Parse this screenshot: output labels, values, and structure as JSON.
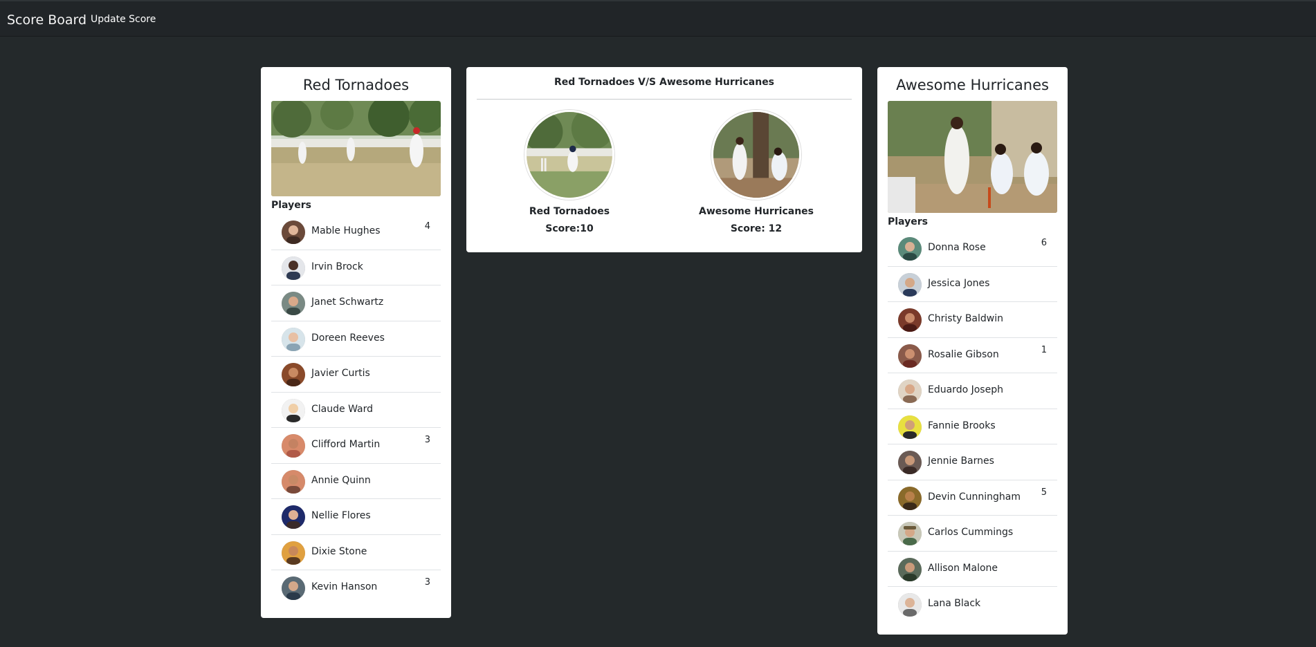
{
  "navbar": {
    "brand": "Score Board",
    "links": [
      "Update Score"
    ]
  },
  "match": {
    "title": "Red Tornadoes V/S Awesome Hurricanes",
    "teams": [
      {
        "name": "Red Tornadoes",
        "score_label": "Score:10"
      },
      {
        "name": "Awesome Hurricanes",
        "score_label": "Score: 12"
      }
    ]
  },
  "teams": [
    {
      "name": "Red Tornadoes",
      "players_label": "Players",
      "players": [
        {
          "name": "Mable Hughes",
          "score": "4"
        },
        {
          "name": "Irvin Brock",
          "score": ""
        },
        {
          "name": "Janet Schwartz",
          "score": ""
        },
        {
          "name": "Doreen Reeves",
          "score": ""
        },
        {
          "name": "Javier Curtis",
          "score": ""
        },
        {
          "name": "Claude Ward",
          "score": ""
        },
        {
          "name": "Clifford Martin",
          "score": "3"
        },
        {
          "name": "Annie Quinn",
          "score": ""
        },
        {
          "name": "Nellie Flores",
          "score": ""
        },
        {
          "name": "Dixie Stone",
          "score": ""
        },
        {
          "name": "Kevin Hanson",
          "score": "3"
        }
      ]
    },
    {
      "name": "Awesome Hurricanes",
      "players_label": "Players",
      "players": [
        {
          "name": "Donna Rose",
          "score": "6"
        },
        {
          "name": "Jessica Jones",
          "score": ""
        },
        {
          "name": "Christy Baldwin",
          "score": ""
        },
        {
          "name": "Rosalie Gibson",
          "score": "1"
        },
        {
          "name": "Eduardo Joseph",
          "score": ""
        },
        {
          "name": "Fannie Brooks",
          "score": ""
        },
        {
          "name": "Jennie Barnes",
          "score": ""
        },
        {
          "name": "Devin Cunningham",
          "score": "5"
        },
        {
          "name": "Carlos Cummings",
          "score": ""
        },
        {
          "name": "Allison Malone",
          "score": ""
        },
        {
          "name": "Lana Black",
          "score": ""
        }
      ]
    }
  ],
  "colors": {
    "page_background": "#24292b",
    "navbar_background": "#212528",
    "card_background": "#ffffff"
  }
}
